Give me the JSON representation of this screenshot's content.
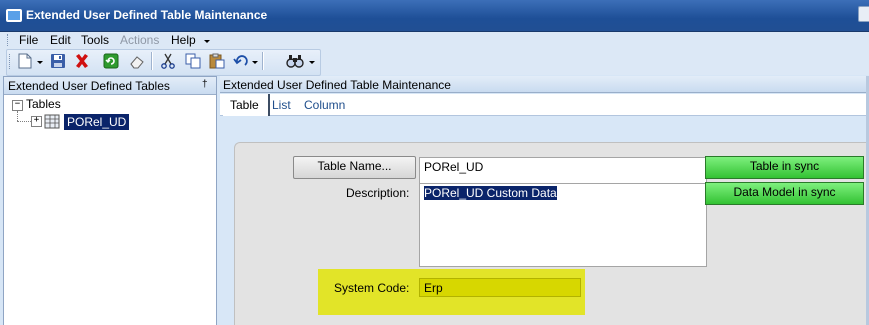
{
  "window": {
    "title": "Extended User Defined Table Maintenance"
  },
  "menu": {
    "items": [
      {
        "label": "File",
        "enabled": true
      },
      {
        "label": "Edit",
        "enabled": true
      },
      {
        "label": "Tools",
        "enabled": true
      },
      {
        "label": "Actions",
        "enabled": false
      },
      {
        "label": "Help",
        "enabled": true
      }
    ]
  },
  "toolbar": {
    "buttons": [
      "new-document-icon",
      "save-icon",
      "delete-icon",
      "refresh-icon",
      "eraser-icon",
      "cut-icon",
      "copy-icon",
      "paste-icon",
      "undo-icon",
      "find-icon"
    ]
  },
  "tree_panel": {
    "header": "Extended User Defined Tables",
    "pin_glyph": "†",
    "root": {
      "label": "Tables",
      "expander": "−"
    },
    "child": {
      "label": "PORel_UD",
      "expander": "+"
    }
  },
  "main_panel": {
    "header": "Extended User Defined Table Maintenance",
    "tabs": [
      {
        "label": "Table",
        "active": true
      },
      {
        "label": "List",
        "active": false
      },
      {
        "label": "Column",
        "active": false
      }
    ]
  },
  "form": {
    "table_name_button": "Table Name...",
    "table_name_value": "PORel_UD",
    "description_label": "Description:",
    "description_value": "PORel_UD Custom Data",
    "system_code_label": "System Code:",
    "system_code_value": "Erp",
    "table_status": "Table in sync",
    "data_model_status": "Data Model in sync"
  },
  "colors": {
    "titlebar": "#1e4f97",
    "status_green": "#33c233",
    "highlight_yellow": "#e2e41e",
    "selection": "#0a246a"
  }
}
